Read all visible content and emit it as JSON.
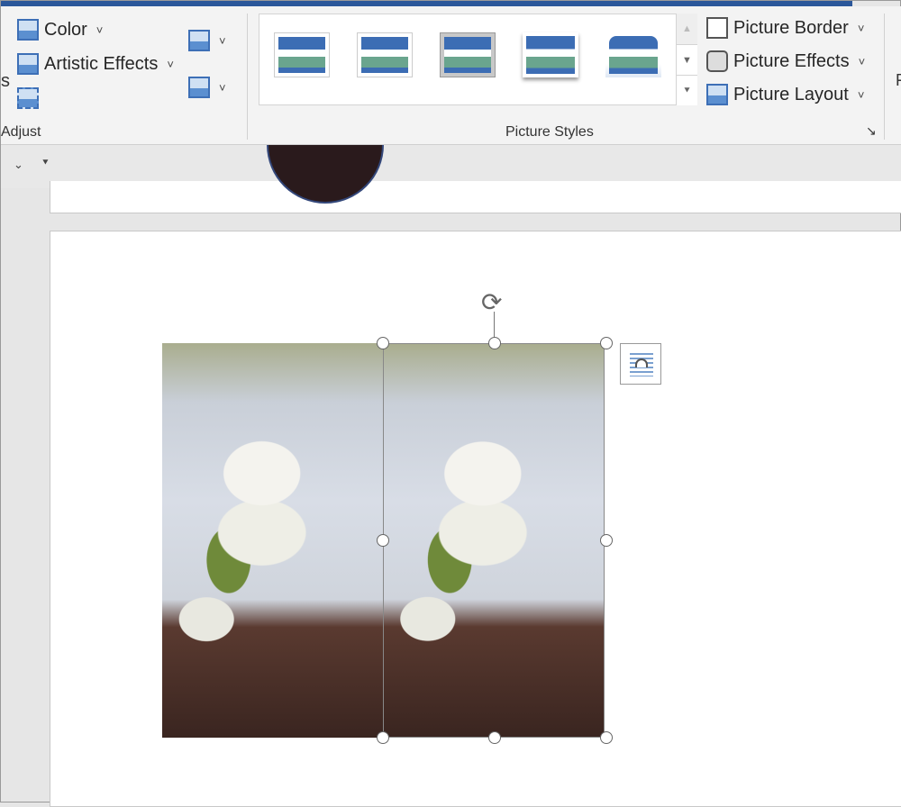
{
  "ribbon": {
    "adjust": {
      "color": "Color",
      "artistic_effects": "Artistic Effects",
      "group_label": "Adjust",
      "partial_label": "s"
    },
    "picture_styles": {
      "group_label": "Picture Styles",
      "picture_border": "Picture Border",
      "picture_effects": "Picture Effects",
      "picture_layout": "Picture Layout",
      "selected_style_index": 2
    },
    "right_partial": "F"
  },
  "icons": {
    "chevron": "⌄",
    "scroll_up": "▲",
    "scroll_down": "▼",
    "more": "⯆",
    "launcher": "↘",
    "rotate": "⟳"
  }
}
